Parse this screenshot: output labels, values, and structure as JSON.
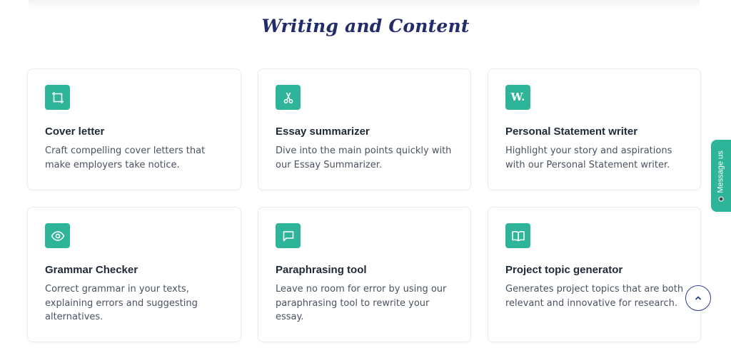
{
  "section": {
    "title": "Writing and Content"
  },
  "cards": [
    {
      "icon": "frame-icon",
      "title": "Cover letter",
      "desc": "Craft compelling cover letters that make employers take notice."
    },
    {
      "icon": "scissors-icon",
      "title": "Essay summarizer",
      "desc": "Dive into the main points quickly with our Essay Summarizer."
    },
    {
      "icon": "w-letter-icon",
      "icon_text": "W.",
      "title": "Personal Statement writer",
      "desc": "Highlight your story and aspirations with our Personal Statement writer."
    },
    {
      "icon": "eye-icon",
      "title": "Grammar Checker",
      "desc": "Correct grammar in your texts, explaining errors and suggesting alternatives."
    },
    {
      "icon": "message-square-icon",
      "title": "Paraphrasing tool",
      "desc": "Leave no room for error by using our paraphrasing tool to rewrite your essay."
    },
    {
      "icon": "book-open-icon",
      "title": "Project topic generator",
      "desc": "Generates project topics that are both relevant and innovative for research."
    }
  ],
  "message_tab": {
    "label": "Message us"
  },
  "colors": {
    "accent": "#2eb599",
    "title": "#232c6b",
    "heading": "#1f2a37",
    "body": "#4a5260",
    "scroll_border": "#2e3b8e"
  }
}
